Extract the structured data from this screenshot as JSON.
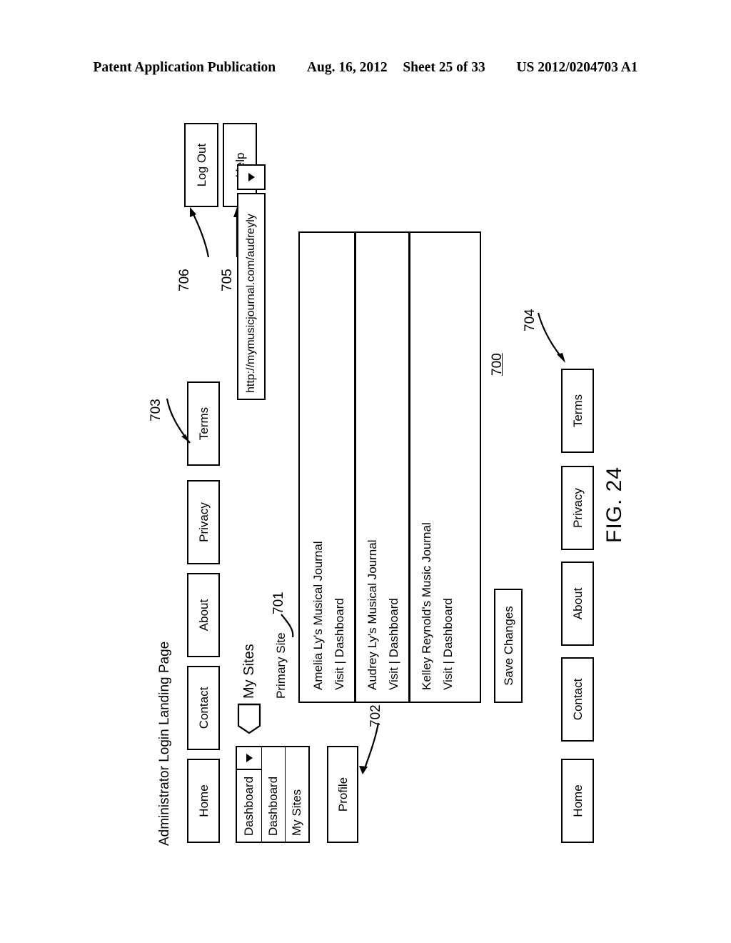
{
  "publication_header": {
    "left": "Patent Application Publication",
    "date": "Aug. 16, 2012",
    "sheet": "Sheet 25 of 33",
    "number": "US 2012/0204703 A1"
  },
  "figure": {
    "label": "FIG. 24",
    "page_title": "Administrator Login Landing Page",
    "reference_numerals": {
      "panel": "700",
      "primary_site": "701",
      "profile": "702",
      "terms_top": "703",
      "terms_bottom": "704",
      "help": "705",
      "log_out": "706"
    }
  },
  "top_nav": {
    "items": [
      {
        "label": "Home"
      },
      {
        "label": "Contact"
      },
      {
        "label": "About"
      },
      {
        "label": "Privacy"
      },
      {
        "label": "Terms"
      }
    ]
  },
  "bottom_nav": {
    "items": [
      {
        "label": "Home"
      },
      {
        "label": "Contact"
      },
      {
        "label": "About"
      },
      {
        "label": "Privacy"
      },
      {
        "label": "Terms"
      }
    ]
  },
  "account_actions": {
    "log_out": "Log Out",
    "help": "Help"
  },
  "dashboard_dropdown": {
    "selected": "Dashboard",
    "options": [
      {
        "label": "Dashboard"
      },
      {
        "label": "My Sites"
      }
    ],
    "arrow_icon": "chevron-down-icon"
  },
  "profile_button": {
    "label": "Profile"
  },
  "url_selector": {
    "value": "http://mymusicjournal.com/audreyly",
    "arrow_icon": "chevron-down-icon"
  },
  "my_sites": {
    "heading": "My Sites",
    "primary_site_label": "Primary Site",
    "sites": [
      {
        "name": "Amelia Ly's Musical Journal",
        "links": "Visit | Dashboard"
      },
      {
        "name": "Audrey Ly's Musical Journal",
        "links": "Visit | Dashboard"
      },
      {
        "name": "Kelley Reynold's Music Journal",
        "links": "Visit | Dashboard"
      }
    ],
    "save_button": "Save Changes"
  }
}
